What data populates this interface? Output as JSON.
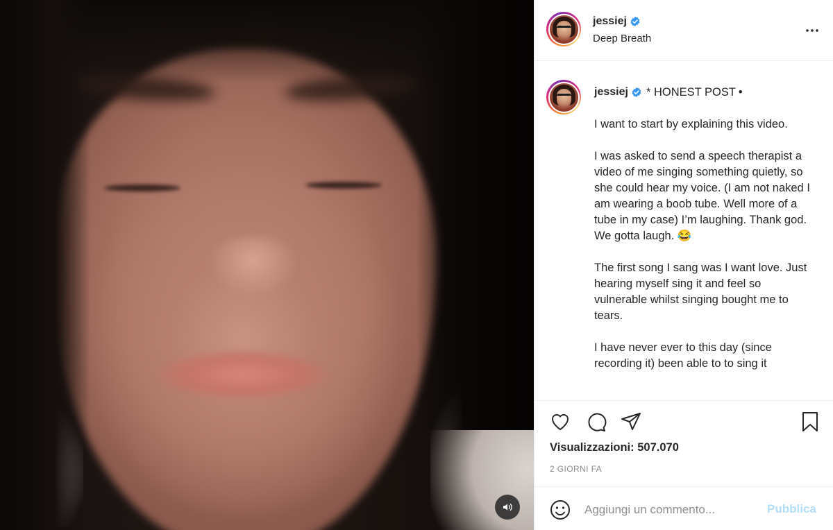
{
  "post": {
    "author": "jessiej",
    "verified": true,
    "audio_title": "Deep Breath"
  },
  "caption": {
    "author": "jessiej",
    "headline": "* HONEST POST",
    "separator": "•",
    "body": "I want to start by explaining this video.\n\nI was asked to send a speech therapist a video of me singing something quietly, so she could hear my voice. (I am not naked I am wearing a boob tube. Well more of a tube in my case) I’m laughing. Thank god. We gotta laugh. 😂\n\nThe first song I sang was I want love. Just hearing myself sing it and feel so vulnerable whilst singing bought me to tears.\n\nI have never ever to this day (since recording it) been able to to sing it"
  },
  "stats": {
    "views_label": "Visualizzazioni:",
    "views_value": "507.070",
    "date": "2 GIORNI FA"
  },
  "comment": {
    "placeholder": "Aggiungi un commento...",
    "publish_label": "Pubblica"
  },
  "icons": {
    "verified": "verified-badge-icon",
    "more": "more-options-icon",
    "like": "heart-icon",
    "comment": "comment-bubble-icon",
    "share": "paper-plane-icon",
    "save": "bookmark-icon",
    "emoji": "smiley-icon",
    "audio": "speaker-icon"
  },
  "colors": {
    "verified_blue": "#3897f0",
    "publish_disabled": "#b2dffc",
    "muted_text": "#8e8e8e",
    "divider": "#efefef"
  }
}
